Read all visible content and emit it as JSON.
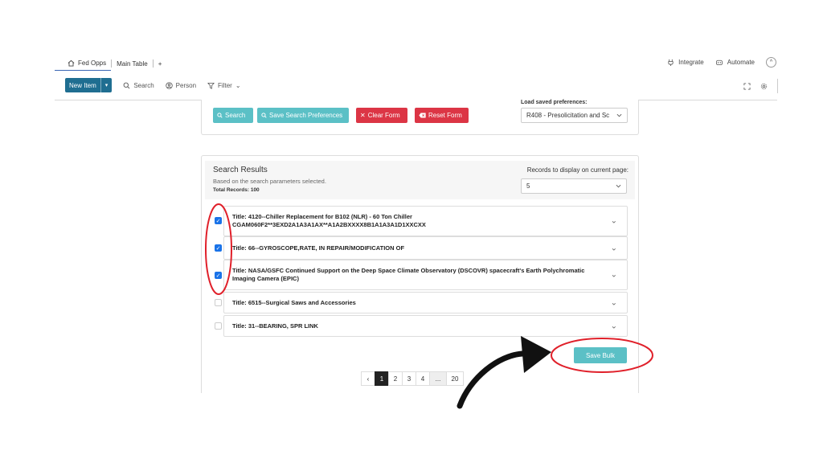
{
  "tabs": {
    "home": "Fed Opps",
    "main_table": "Main Table",
    "add": "+"
  },
  "top_right": {
    "integrate": "Integrate",
    "automate": "Automate",
    "collapse": "^"
  },
  "toolbar": {
    "new_item": "New Item",
    "new_item_dropdown": "▾",
    "search": "Search",
    "person": "Person",
    "filter": "Filter",
    "filter_dropdown": "⌄"
  },
  "form": {
    "search_btn": "Search",
    "save_pref_btn": "Save Search Preferences",
    "clear_btn": "Clear Form",
    "reset_btn": "Reset Form",
    "load_label": "Load saved preferences:",
    "load_value": "R408 - Presolicitation and Sc"
  },
  "results": {
    "title": "Search Results",
    "subtitle": "Based on the search parameters selected.",
    "total": "Total Records: 100",
    "records_label": "Records to display on current page:",
    "records_value": "5",
    "items": [
      {
        "title": "Title: 4120--Chiller Replacement for B102 (NLR) - 60 Ton Chiller CGAM060F2**3EXD2A1A3A1AX**A1A2BXXXX8B1A1A3A1D1XXCXX",
        "checked": true
      },
      {
        "title": "Title: 66--GYROSCOPE,RATE, IN REPAIR/MODIFICATION OF",
        "checked": true
      },
      {
        "title": "Title: NASA/GSFC Continued Support on the Deep Space Climate Observatory (DSCOVR) spacecraft's Earth Polychromatic Imaging Camera (EPIC)",
        "checked": true
      },
      {
        "title": "Title: 6515--Surgical Saws and Accessories",
        "checked": false
      },
      {
        "title": "Title: 31--BEARING, SPR LINK",
        "checked": false
      }
    ],
    "save_bulk": "Save Bulk"
  },
  "pagination": {
    "prev": "‹",
    "pages": [
      "1",
      "2",
      "3",
      "4"
    ],
    "ellipsis": "...",
    "last": "20",
    "active": "1"
  },
  "colors": {
    "teal": "#5bc0c6",
    "red": "#dc3545",
    "brand": "#1f6e91",
    "checkbox": "#1a73e8",
    "annotation": "#e0202a"
  }
}
